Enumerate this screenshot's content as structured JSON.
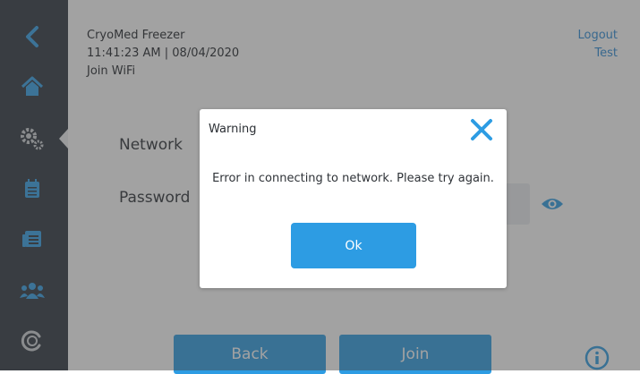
{
  "header": {
    "device_name": "CryoMed Freezer",
    "datetime": "11:41:23 AM | 08/04/2020",
    "page_title": "Join WiFi",
    "logout_label": "Logout",
    "user_name": "Test"
  },
  "sidebar": {
    "items": [
      {
        "icon": "back-chevron-icon"
      },
      {
        "icon": "home-icon"
      },
      {
        "icon": "settings-gears-icon",
        "active": true
      },
      {
        "icon": "calendar-icon"
      },
      {
        "icon": "logs-icon"
      },
      {
        "icon": "users-icon"
      },
      {
        "icon": "calibration-icon"
      }
    ]
  },
  "form": {
    "network_label": "Network",
    "password_label": "Password",
    "back_label": "Back",
    "join_label": "Join"
  },
  "dialog": {
    "title": "Warning",
    "message": "Error in connecting to network. Please try again.",
    "ok_label": "Ok"
  },
  "colors": {
    "accent": "#2d9ce3",
    "sidebar": "#2c343e",
    "overlay": "rgba(70,70,70,0.5)"
  }
}
